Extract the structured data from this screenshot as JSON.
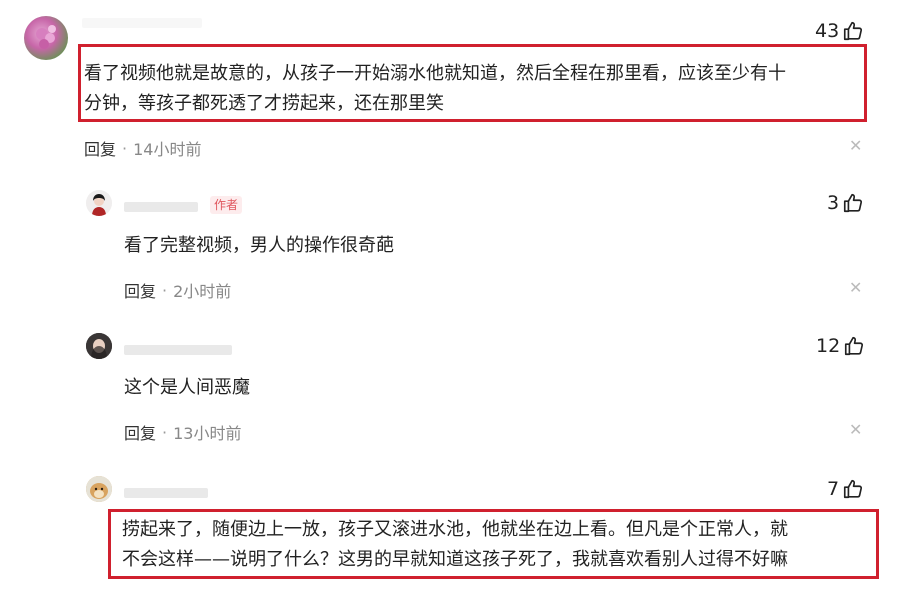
{
  "comments": [
    {
      "likes": "43",
      "text_lines": [
        "看了视频他就是故意的，从孩子一开始溺水他就知道，然后全程在那里看，应该至少有十",
        "分钟，等孩子都死透了才捞起来，还在那里笑"
      ],
      "reply_label": "回复",
      "time": "14小时前",
      "highlighted": true
    },
    {
      "likes": "3",
      "author_badge": "作者",
      "text_lines": [
        "看了完整视频，男人的操作很奇葩"
      ],
      "reply_label": "回复",
      "time": "2小时前",
      "highlighted": false
    },
    {
      "likes": "12",
      "text_lines": [
        "这个是人间恶魔"
      ],
      "reply_label": "回复",
      "time": "13小时前",
      "highlighted": false
    },
    {
      "likes": "7",
      "text_lines": [
        "捞起来了，随便边上一放，孩子又滚进水池，他就坐在边上看。但凡是个正常人，就",
        "不会这样——说明了什么？这男的早就知道这孩子死了，我就喜欢看别人过得不好嘛"
      ],
      "highlighted": true
    }
  ],
  "icons": {
    "like": "thumbs-up-icon",
    "close": "close-icon"
  },
  "colors": {
    "highlight_box": "#d0202e",
    "author_badge": "#e0565e"
  }
}
